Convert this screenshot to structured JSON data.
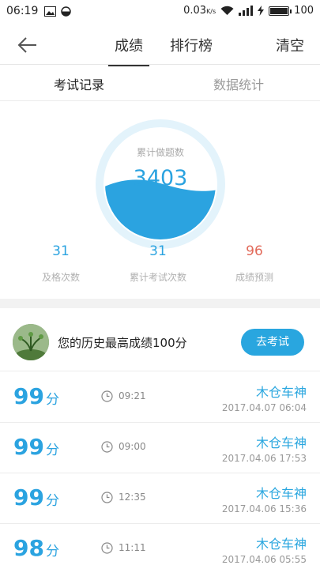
{
  "status_bar": {
    "time": "06:19",
    "net_speed": "0.03",
    "net_unit": "K/s",
    "battery": "100"
  },
  "nav": {
    "tabs": [
      {
        "label": "成绩",
        "active": true
      },
      {
        "label": "排行榜",
        "active": false
      }
    ],
    "clear_label": "清空"
  },
  "sub_tabs": [
    {
      "label": "考试记录",
      "active": true
    },
    {
      "label": "数据统计",
      "active": false
    }
  ],
  "gauge": {
    "label": "累计做题数",
    "value": "3403"
  },
  "stats": [
    {
      "value": "31",
      "label": "及格次数",
      "color": "#2ba3e0"
    },
    {
      "value": "31",
      "label": "累计考试次数",
      "color": "#2ba3e0"
    },
    {
      "value": "96",
      "label": "成绩预测",
      "color": "#e26a5a"
    }
  ],
  "best": {
    "text": "您的历史最高成绩100分",
    "button": "去考试"
  },
  "records": [
    {
      "score": "99",
      "unit": "分",
      "duration": "09:21",
      "name": "木仓车神",
      "date": "2017.04.07  06:04"
    },
    {
      "score": "99",
      "unit": "分",
      "duration": "09:00",
      "name": "木仓车神",
      "date": "2017.04.06  17:53"
    },
    {
      "score": "99",
      "unit": "分",
      "duration": "12:35",
      "name": "木仓车神",
      "date": "2017.04.06  15:36"
    },
    {
      "score": "98",
      "unit": "分",
      "duration": "11:11",
      "name": "木仓车神",
      "date": "2017.04.06  05:55"
    }
  ],
  "colors": {
    "accent": "#29a6df",
    "predict": "#e26a5a"
  }
}
